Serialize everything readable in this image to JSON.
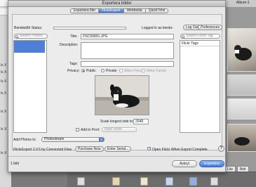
{
  "window": {
    "title": "Exportera bilder"
  },
  "tabs": [
    {
      "label": "Exportera filer",
      "active": false
    },
    {
      "label": "FlickrExport",
      "active": true
    },
    {
      "label": "Webbsida",
      "active": false
    },
    {
      "label": "QuickTime",
      "active": false
    }
  ],
  "status": {
    "bandwidth_label": "Bandwidth Status:",
    "logged_in_text": "Logged in as kiesks",
    "logout_label": "Log Out",
    "preferences_label": "Preferences"
  },
  "left_panel": {
    "search_placeholder": "Search Photos"
  },
  "form": {
    "title_label": "Title:",
    "title_value": "DSC06891.JPG",
    "description_label": "Description:",
    "tags_label": "Tags:",
    "privacy_label": "Privacy:",
    "privacy_options": [
      "Public",
      "Private",
      "Allow Friends",
      "Allow Family"
    ],
    "privacy_selected": "Public",
    "scale_label": "Scale longest side to:",
    "scale_value": "2048",
    "add_to_pool_label": "Add to Pool:",
    "pool_value": "Inget värde"
  },
  "right_panel": {
    "search_placeholder": "Search Flickr Tag",
    "header": "Flickr Tags"
  },
  "bottom": {
    "add_photos_label": "Add Photos to:",
    "add_photos_value": "Photostream",
    "version_text": "FlickrExport 2.0.5 by Connected Flow",
    "purchase_label": "Purchase Now",
    "serial_label": "Enter Serial...",
    "open_flickr_label": "Open Flickr When Export Complete",
    "open_flickr_checked": true,
    "help_label": "?"
  },
  "footer": {
    "count_text": "1 bild",
    "cancel_label": "Avbryt",
    "export_label": "Exportera"
  },
  "background": {
    "album_label": "Album-1",
    "side_labels": [
      "ls X",
      "ls X",
      "ls X",
      "ls X",
      "ls X",
      "ls X",
      "ls X"
    ],
    "tab_labels": [
      "Läs",
      "Bok"
    ]
  },
  "colors": {
    "accent": "#4f7fd6",
    "dialog_bg": "#e6e6e6"
  }
}
